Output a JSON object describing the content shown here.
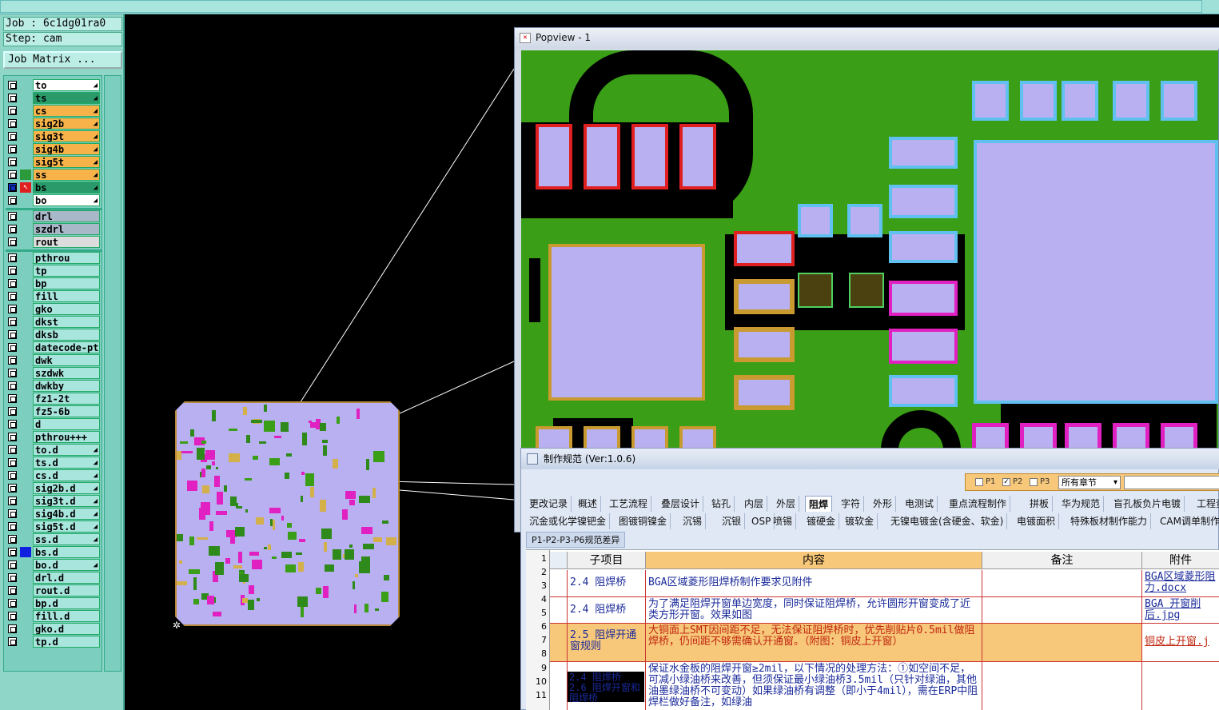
{
  "info": {
    "job": "Job : 6c1dg01ra0",
    "step": "Step: cam",
    "job_matrix": "Job Matrix ..."
  },
  "layers": [
    {
      "name": "to",
      "color": "#ffffff"
    },
    {
      "name": "ts",
      "color": "#2a9a6a"
    },
    {
      "name": "cs",
      "color": "#f7b34a"
    },
    {
      "name": "sig2b",
      "color": "#f7b34a"
    },
    {
      "name": "sig3t",
      "color": "#f7b34a"
    },
    {
      "name": "sig4b",
      "color": "#f7b34a"
    },
    {
      "name": "sig5t",
      "color": "#f7b34a"
    },
    {
      "name": "ss",
      "color": "#f7b34a"
    },
    {
      "name": "bs",
      "color": "#2a9a6a"
    },
    {
      "name": "bo",
      "color": "#ffffff"
    },
    {
      "name": "drl",
      "color": "#a8b8c8"
    },
    {
      "name": "szdrl",
      "color": "#a8b8c8"
    },
    {
      "name": "rout",
      "color": "#dcdcdc"
    },
    {
      "name": "pthrou",
      "color": "#a8e6dd"
    },
    {
      "name": "tp",
      "color": "#a8e6dd"
    },
    {
      "name": "bp",
      "color": "#a8e6dd"
    },
    {
      "name": "fill",
      "color": "#a8e6dd"
    },
    {
      "name": "gko",
      "color": "#a8e6dd"
    },
    {
      "name": "dkst",
      "color": "#a8e6dd"
    },
    {
      "name": "dksb",
      "color": "#a8e6dd"
    },
    {
      "name": "datecode-pte",
      "color": "#a8e6dd"
    },
    {
      "name": "dwk",
      "color": "#a8e6dd"
    },
    {
      "name": "szdwk",
      "color": "#a8e6dd"
    },
    {
      "name": "dwkby",
      "color": "#a8e6dd"
    },
    {
      "name": "fz1-2t",
      "color": "#a8e6dd"
    },
    {
      "name": "fz5-6b",
      "color": "#a8e6dd"
    },
    {
      "name": "d",
      "color": "#a8e6dd"
    },
    {
      "name": "pthrou+++",
      "color": "#a8e6dd"
    },
    {
      "name": "to.d",
      "color": "#a8e6dd"
    },
    {
      "name": "ts.d",
      "color": "#a8e6dd"
    },
    {
      "name": "cs.d",
      "color": "#a8e6dd"
    },
    {
      "name": "sig2b.d",
      "color": "#a8e6dd"
    },
    {
      "name": "sig3t.d",
      "color": "#a8e6dd"
    },
    {
      "name": "sig4b.d",
      "color": "#a8e6dd"
    },
    {
      "name": "sig5t.d",
      "color": "#a8e6dd"
    },
    {
      "name": "ss.d",
      "color": "#a8e6dd"
    },
    {
      "name": "bs.d",
      "color": "#a8e6dd"
    },
    {
      "name": "bo.d",
      "color": "#a8e6dd"
    },
    {
      "name": "drl.d",
      "color": "#a8e6dd"
    },
    {
      "name": "rout.d",
      "color": "#a8e6dd"
    },
    {
      "name": "bp.d",
      "color": "#a8e6dd"
    },
    {
      "name": "fill.d",
      "color": "#a8e6dd"
    },
    {
      "name": "gko.d",
      "color": "#a8e6dd"
    },
    {
      "name": "tp.d",
      "color": "#a8e6dd"
    }
  ],
  "popview": {
    "title": "Popview - 1"
  },
  "spec": {
    "title": "制作规范 (Ver:1.0.6)",
    "filter": {
      "p1": "P1",
      "p2": "P2",
      "p3": "P3",
      "chapter": "所有章节"
    },
    "tabs_row1": [
      "更改记录",
      "概述",
      "工艺流程",
      "叠层设计",
      "钻孔",
      "内层",
      "外层",
      "阻焊",
      "字符",
      "外形",
      "电测试",
      "重点流程制作",
      "拼板",
      "华为规范",
      "盲孔板负片电镀",
      "工程资"
    ],
    "tabs_row2": [
      "沉金或化学镍钯金",
      "图镀铜镍金",
      "沉锡",
      "沉银",
      "OSP",
      "喷锡",
      "镀硬金",
      "镀软金",
      "无镍电镀金(含硬金、软金)",
      "电镀面积",
      "特殊板材制作能力",
      "CAM调单制作"
    ],
    "subtab": "P1-P2-P3-P6规范差异",
    "headers": {
      "item": "子项目",
      "content": "内容",
      "remark": "备注",
      "attach": "附件"
    },
    "row_numbers": [
      "1",
      "2",
      "3",
      "4",
      "5",
      "6",
      "7",
      "8",
      "9",
      "10",
      "11"
    ],
    "rows": [
      {
        "item": "2.4 阻焊桥",
        "content": "BGA区域菱形阻焊桥制作要求见附件",
        "attach": "BGA区域菱形阻力.docx"
      },
      {
        "item": "2.4 阻焊桥",
        "content": "为了满足阻焊开窗单边宽度，同时保证阻焊桥，允许圆形开窗变成了近类方形开窗。效果如图",
        "attach": "BGA 开窗削后.jpg"
      },
      {
        "item": "2.5 阻焊开通窗规则",
        "content": "大铜面上SMT因间距不足，无法保证阻焊桥时，优先削贴片0.5mil做阻焊桥，仍间距不够需确认开通窗。（附图：铜皮上开窗）",
        "attach": "铜皮上开窗.j"
      },
      {
        "item": "2.4 阻焊桥",
        "content": "保证水金板的阻焊开窗≥2mil，以下情况的处理方法：①如空间不足，可减小绿油桥来改善，但须保证最小绿油桥3.5mil（只针对绿油，其他油墨绿油桥不可变动）如果绿油桥有调整（即小于4mil），需在ERP中阻焊栏做好备注，如绿油",
        "attach": ""
      }
    ],
    "row5_item_overlap": "2.6 阻焊开窗和阻焊桥"
  }
}
